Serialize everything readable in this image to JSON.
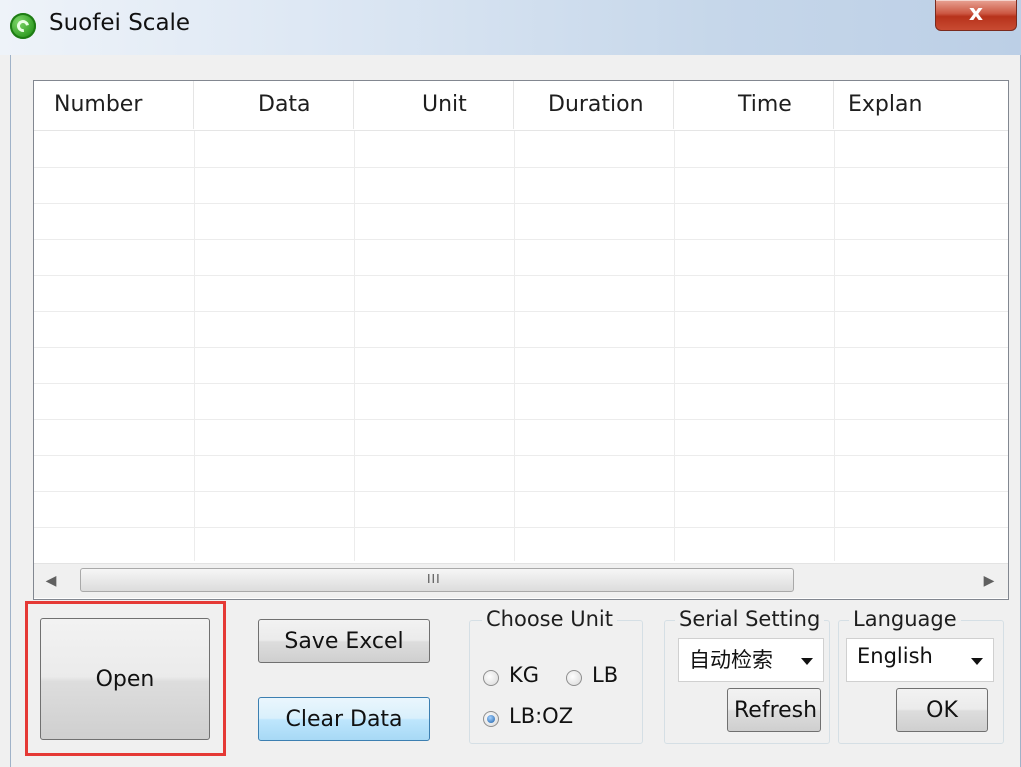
{
  "window": {
    "title": "Suofei Scale",
    "close_label": "x"
  },
  "table": {
    "columns": [
      "Number",
      "Data",
      "Unit",
      "Duration",
      "Time",
      "Explan"
    ],
    "rows": [],
    "scrollbar_grip": "III"
  },
  "actions": {
    "open_label": "Open",
    "save_excel_label": "Save Excel",
    "clear_data_label": "Clear Data"
  },
  "unit_group": {
    "label": "Choose Unit",
    "options": [
      "KG",
      "LB",
      "LB:OZ"
    ],
    "selected": "LB:OZ"
  },
  "serial_group": {
    "label": "Serial Setting",
    "selected": "自动检索",
    "refresh_label": "Refresh"
  },
  "language_group": {
    "label": "Language",
    "selected": "English",
    "ok_label": "OK"
  },
  "colors": {
    "highlight": "#e53935",
    "clear_button_border": "#3c7fb1",
    "app_icon": "#2c9a1f"
  },
  "icons": {
    "app": "suofei-logo-icon",
    "close": "close-icon",
    "scroll_left": "scroll-left-icon",
    "scroll_right": "scroll-right-icon",
    "dropdown": "chevron-down-icon"
  }
}
